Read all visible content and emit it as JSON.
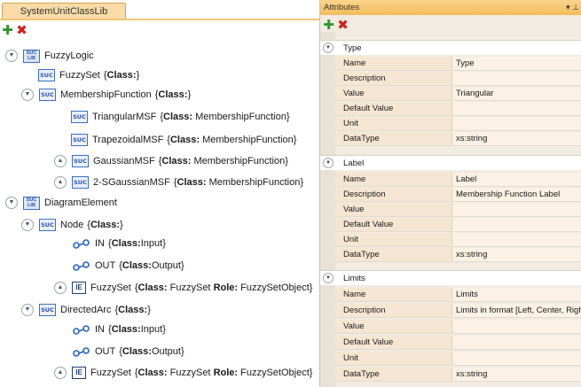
{
  "left_panel": {
    "tab_label": "SystemUnitClassLib",
    "toolbar": {
      "add_icon": "plus-icon",
      "delete_icon": "delete-icon"
    },
    "tree": {
      "fuzzy_logic": "FuzzyLogic",
      "fuzzy_set": {
        "name": "FuzzySet",
        "open": "{",
        "kw": "Class:",
        "val": "",
        "close": "}"
      },
      "membership_function": {
        "name": "MembershipFunction",
        "open": "{",
        "kw": "Class:",
        "val": "",
        "close": "}"
      },
      "triangular": {
        "name": "TriangularMSF",
        "open": "{",
        "kw": "Class:",
        "val": "MembershipFunction",
        "close": "}"
      },
      "trapezoidal": {
        "name": "TrapezoidalMSF",
        "open": "{",
        "kw": "Class:",
        "val": "MembershipFunction",
        "close": "}"
      },
      "gaussian": {
        "name": "GaussianMSF",
        "open": "{",
        "kw": "Class:",
        "val": "MembershipFunction",
        "close": "}"
      },
      "sgaussian": {
        "name": "2-SGaussianMSF",
        "open": "{",
        "kw": "Class:",
        "val": "MembershipFunction",
        "close": "}"
      },
      "diagram_element": "DiagramElement",
      "node": {
        "name": "Node",
        "open": "{",
        "kw": "Class:",
        "val": "",
        "close": "}"
      },
      "node_in": {
        "name": "IN",
        "open": "{",
        "kw": "Class:",
        "val": "Input",
        "close": "}"
      },
      "node_out": {
        "name": "OUT",
        "open": "{",
        "kw": "Class:",
        "val": "Output",
        "close": "}"
      },
      "node_fuzzyset": {
        "name": "FuzzySet",
        "open": "{",
        "kw": "Class:",
        "val": "FuzzySet",
        "kw2": "Role:",
        "val2": "FuzzySetObject",
        "close": "}"
      },
      "directed_arc": {
        "name": "DirectedArc",
        "open": "{",
        "kw": "Class:",
        "val": "",
        "close": "}"
      },
      "arc_in": {
        "name": "IN",
        "open": "{",
        "kw": "Class:",
        "val": "Input",
        "close": "}"
      },
      "arc_out": {
        "name": "OUT",
        "open": "{",
        "kw": "Class:",
        "val": "Output",
        "close": "}"
      },
      "arc_fuzzyset": {
        "name": "FuzzySet",
        "open": "{",
        "kw": "Class:",
        "val": "FuzzySet",
        "kw2": "Role:",
        "val2": "FuzzySetObject",
        "close": "}"
      }
    },
    "icon_text": {
      "suc": "SUC",
      "ie": "IE",
      "lib_top": "SUC",
      "lib_bottom": "LIB"
    }
  },
  "attributes_panel": {
    "title": "Attributes",
    "pin_glyph": "▾ ⊥",
    "sections": [
      {
        "title": "Type",
        "rows": [
          {
            "key": "Name",
            "value": "Type"
          },
          {
            "key": "Description",
            "value": ""
          },
          {
            "key": "Value",
            "value": "Triangular"
          },
          {
            "key": "Default Value",
            "value": ""
          },
          {
            "key": "Unit",
            "value": ""
          },
          {
            "key": "DataType",
            "value": "xs:string"
          }
        ]
      },
      {
        "title": "Label",
        "rows": [
          {
            "key": "Name",
            "value": "Label"
          },
          {
            "key": "Description",
            "value": "Membership Function Label"
          },
          {
            "key": "Value",
            "value": ""
          },
          {
            "key": "Default Value",
            "value": ""
          },
          {
            "key": "Unit",
            "value": ""
          },
          {
            "key": "DataType",
            "value": "xs:string"
          }
        ]
      },
      {
        "title": "Limits",
        "rows": [
          {
            "key": "Name",
            "value": "Limits"
          },
          {
            "key": "Description",
            "value": "Limits in format [Left, Center, Right]"
          },
          {
            "key": "Value",
            "value": ""
          },
          {
            "key": "Default Value",
            "value": ""
          },
          {
            "key": "Unit",
            "value": ""
          },
          {
            "key": "DataType",
            "value": "xs:string"
          }
        ]
      }
    ]
  },
  "colors": {
    "tab_bg": "#f9dca8",
    "header_bg": "#f2bb5a",
    "suc_icon": "#3d6fc4",
    "add_green": "#2c9a2c",
    "delete_red": "#d0201e"
  }
}
